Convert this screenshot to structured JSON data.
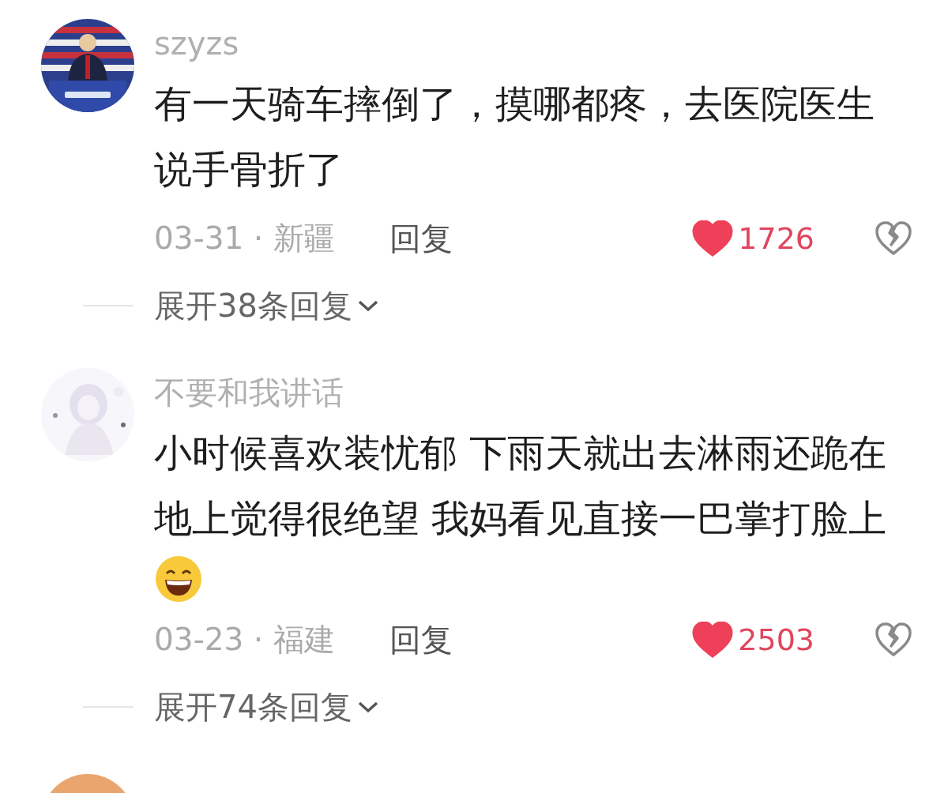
{
  "comments": [
    {
      "username": "szyzs",
      "text": "有一天骑车摔倒了，摸哪都疼，去医院医生说手骨折了",
      "trailing_emoji": false,
      "meta": "03-31 · 新疆",
      "reply_label": "回复",
      "liked": true,
      "like_count": "1726",
      "disliked": false,
      "expand_label": "展开38条回复"
    },
    {
      "avatar": {
        "kind": "illustration"
      },
      "username": "不要和我讲话",
      "text": "小时候喜欢装忧郁 下雨天就出去淋雨还跪在地上觉得很绝望 我妈看见直接一巴掌打脸上",
      "trailing_emoji": true,
      "meta": "03-23 · 福建",
      "reply_label": "回复",
      "liked": true,
      "like_count": "2503",
      "disliked": false,
      "expand_label": "展开74条回复"
    },
    {
      "avatar": {
        "kind": "plain",
        "color": "#eaa56e"
      }
    }
  ]
}
